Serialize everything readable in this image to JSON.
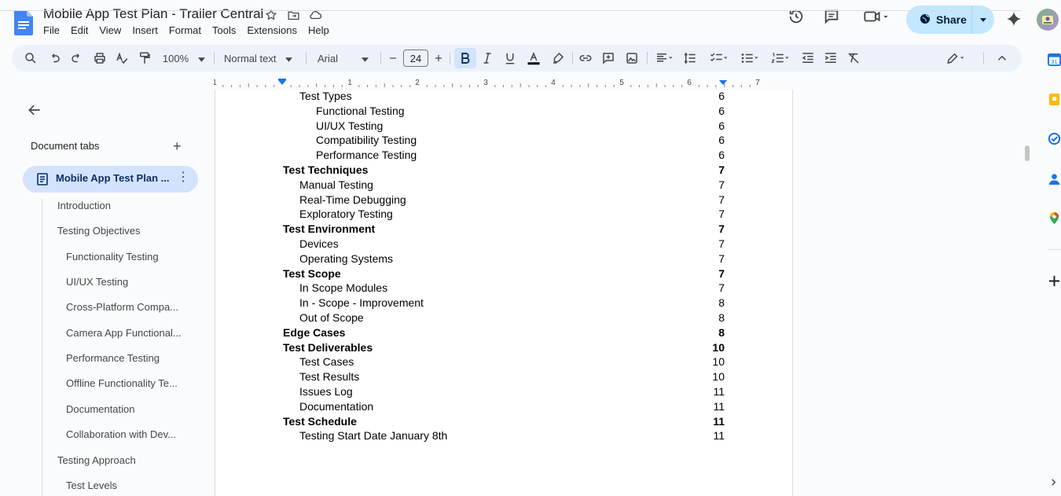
{
  "header": {
    "title": "Mobile App Test Plan - Trailer Central",
    "menu": [
      "File",
      "Edit",
      "View",
      "Insert",
      "Format",
      "Tools",
      "Extensions",
      "Help"
    ],
    "share_label": "Share"
  },
  "toolbar": {
    "zoom": "100%",
    "style": "Normal text",
    "font": "Arial",
    "font_size": "24"
  },
  "ruler": {
    "numbers": [
      "1",
      "1",
      "2",
      "3",
      "4",
      "5",
      "6",
      "7"
    ]
  },
  "left_panel": {
    "doc_tabs_label": "Document tabs",
    "active_tab": "Mobile App Test Plan ...",
    "outline": [
      {
        "label": "Introduction",
        "level": 1
      },
      {
        "label": "Testing Objectives",
        "level": 1
      },
      {
        "label": "Functionality Testing",
        "level": 2
      },
      {
        "label": "UI/UX Testing",
        "level": 2
      },
      {
        "label": "Cross-Platform Compa...",
        "level": 2
      },
      {
        "label": "Camera App Functional...",
        "level": 2
      },
      {
        "label": "Performance Testing",
        "level": 2
      },
      {
        "label": "Offline Functionality Te...",
        "level": 2
      },
      {
        "label": "Documentation",
        "level": 2
      },
      {
        "label": "Collaboration with Dev...",
        "level": 2
      },
      {
        "label": "Testing Approach",
        "level": 1
      },
      {
        "label": "Test Levels",
        "level": 1
      }
    ]
  },
  "toc": [
    {
      "text": "Test Types",
      "page": "6",
      "level": 2
    },
    {
      "text": "Functional Testing",
      "page": "6",
      "level": 3
    },
    {
      "text": "UI/UX Testing",
      "page": "6",
      "level": 3
    },
    {
      "text": "Compatibility Testing",
      "page": "6",
      "level": 3
    },
    {
      "text": "Performance Testing",
      "page": "6",
      "level": 3
    },
    {
      "text": "Test Techniques",
      "page": "7",
      "level": 1
    },
    {
      "text": "Manual Testing",
      "page": "7",
      "level": 2
    },
    {
      "text": "Real-Time Debugging",
      "page": "7",
      "level": 2
    },
    {
      "text": "Exploratory Testing",
      "page": "7",
      "level": 2
    },
    {
      "text": "Test Environment",
      "page": "7",
      "level": 1
    },
    {
      "text": "Devices",
      "page": "7",
      "level": 2
    },
    {
      "text": "Operating Systems",
      "page": "7",
      "level": 2
    },
    {
      "text": "Test Scope",
      "page": "7",
      "level": 1
    },
    {
      "text": "In Scope Modules",
      "page": "7",
      "level": 2
    },
    {
      "text": "In - Scope - Improvement",
      "page": "8",
      "level": 2
    },
    {
      "text": "Out of Scope",
      "page": "8",
      "level": 2
    },
    {
      "text": "Edge Cases",
      "page": "8",
      "level": 1
    },
    {
      "text": "Test Deliverables",
      "page": "10",
      "level": 1
    },
    {
      "text": "Test Cases",
      "page": "10",
      "level": 2
    },
    {
      "text": "Test Results",
      "page": "10",
      "level": 2
    },
    {
      "text": "Issues Log",
      "page": "11",
      "level": 2
    },
    {
      "text": "Documentation",
      "page": "11",
      "level": 2
    },
    {
      "text": "Test Schedule",
      "page": "11",
      "level": 1
    },
    {
      "text": "Testing Start Date January 8th",
      "page": "11",
      "level": 2
    }
  ],
  "colors": {
    "accent": "#1a73e8",
    "share_bg": "#c2e7ff",
    "active_tab_bg": "#d3e3fd",
    "toolbar_bg": "#edf2fa"
  }
}
